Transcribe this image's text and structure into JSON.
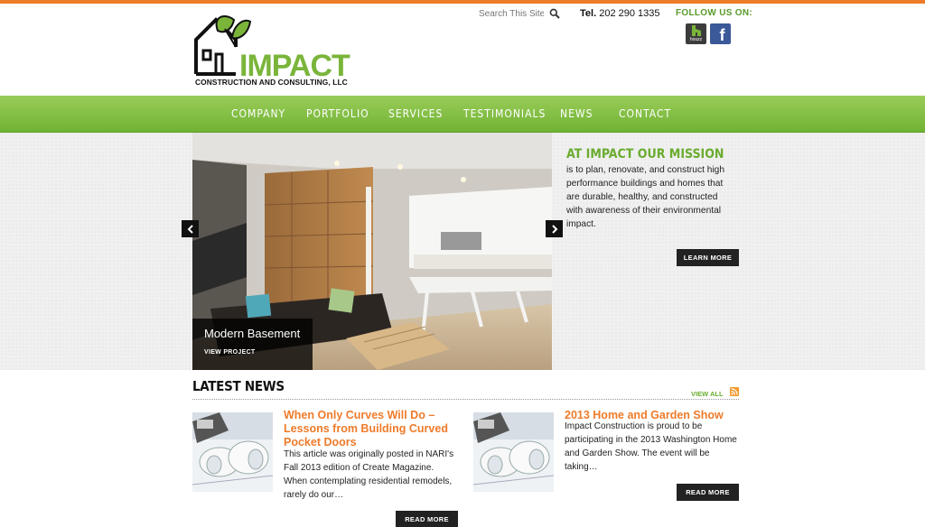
{
  "header": {
    "logo": {
      "word": "IMPACT",
      "subtitle": "CONSTRUCTION AND CONSULTING, LLC"
    },
    "search_placeholder": "Search This Site",
    "phone_label": "Tel.",
    "phone_number": "202 290 1335",
    "follow_label": "FOLLOW US ON:",
    "social": [
      {
        "name": "houzz",
        "label": "houzz",
        "color": "#3c3c3c"
      },
      {
        "name": "facebook",
        "label": "f",
        "color": "#3b5998"
      }
    ]
  },
  "nav": {
    "items": [
      {
        "label": "COMPANY"
      },
      {
        "label": "PORTFOLIO"
      },
      {
        "label": "SERVICES"
      },
      {
        "label": "TESTIMONIALS"
      },
      {
        "label": "NEWS"
      },
      {
        "label": "CONTACT"
      }
    ],
    "color": "#7ab53a"
  },
  "hero": {
    "caption_title": "Modern Basement",
    "caption_link": "VIEW PROJECT",
    "prev_icon": "chevron-left-icon",
    "next_icon": "chevron-right-icon"
  },
  "mission": {
    "title": "AT IMPACT OUR MISSION",
    "text": "is to plan, renovate, and construct high performance buildings and homes that are durable, healthy, and constructed with awareness of their environmental impact.",
    "button": "LEARN MORE"
  },
  "news": {
    "heading": "LATEST NEWS",
    "view_all": "VIEW ALL",
    "posts": [
      {
        "title": "When Only Curves Will Do – Lessons from Building Curved Pocket Doors",
        "excerpt": "This article was originally posted in NARI's Fall 2013 edition of Create Magazine. When contemplating residential remodels, rarely do our…",
        "button": "READ MORE"
      },
      {
        "title": "2013 Home and Garden Show",
        "excerpt": "Impact Construction is proud to be participating in the 2013 Washington Home and Garden Show. The event will be taking…",
        "button": "READ MORE"
      }
    ]
  },
  "colors": {
    "accent_orange": "#ee7b2a",
    "brand_green": "#6aac2f",
    "dark": "#222222"
  }
}
